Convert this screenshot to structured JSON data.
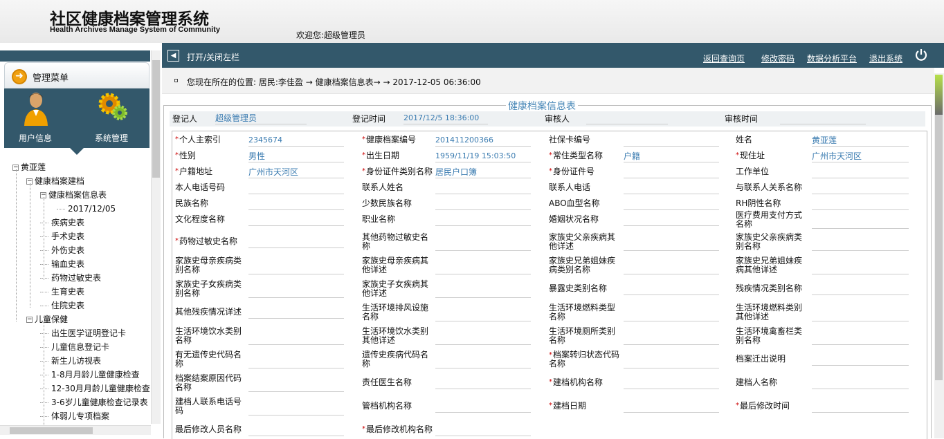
{
  "header": {
    "title": "社区健康档案管理系统",
    "subtitle": "Health Archives Manage System of Community",
    "welcome": "欢迎您:超级管理员"
  },
  "sidebar": {
    "menu_title": "管理菜单",
    "user_label": "用户信息",
    "system_label": "系统管理",
    "tree": [
      {
        "label": "黄亚莲",
        "level": 0,
        "toggle": "-"
      },
      {
        "label": "健康档案建档",
        "level": 1,
        "toggle": "-"
      },
      {
        "label": "健康档案信息表",
        "level": 2,
        "toggle": "-"
      },
      {
        "label": "2017/12/05",
        "level": 3,
        "toggle": ""
      },
      {
        "label": "疾病史表",
        "level": 2,
        "toggle": ""
      },
      {
        "label": "手术史表",
        "level": 2,
        "toggle": ""
      },
      {
        "label": "外伤史表",
        "level": 2,
        "toggle": ""
      },
      {
        "label": "输血史表",
        "level": 2,
        "toggle": ""
      },
      {
        "label": "药物过敏史表",
        "level": 2,
        "toggle": ""
      },
      {
        "label": "生育史表",
        "level": 2,
        "toggle": ""
      },
      {
        "label": "住院史表",
        "level": 2,
        "toggle": ""
      },
      {
        "label": "儿童保健",
        "level": 1,
        "toggle": "-"
      },
      {
        "label": "出生医学证明登记卡",
        "level": 2,
        "toggle": ""
      },
      {
        "label": "儿童信息登记卡",
        "level": 2,
        "toggle": ""
      },
      {
        "label": "新生儿访视表",
        "level": 2,
        "toggle": ""
      },
      {
        "label": "1-8月月龄儿童健康检查",
        "level": 2,
        "toggle": ""
      },
      {
        "label": "12-30月月龄儿童健康检查",
        "level": 2,
        "toggle": ""
      },
      {
        "label": "3-6岁儿童健康检查记录表",
        "level": 2,
        "toggle": ""
      },
      {
        "label": "体弱儿专项档案",
        "level": 2,
        "toggle": ""
      }
    ]
  },
  "topbar": {
    "toggle_label": "打开/关闭左栏",
    "links": [
      "返回查询页",
      "修改密码",
      "数据分析平台",
      "退出系统"
    ]
  },
  "breadcrumb": "您现在所在的位置:  居民:李佳盈 → 健康档案信息表→ → 2017-12-05 06:36:00",
  "form": {
    "legend": "健康档案信息表",
    "registrar_label": "登记人",
    "registrar_value": "超级管理员",
    "reg_time_label": "登记时间",
    "reg_time_value": "2017/12/5 18:36:00",
    "reviewer_label": "审核人",
    "reviewer_value": "",
    "review_time_label": "审核时间",
    "review_time_value": "",
    "rows": [
      [
        [
          "*",
          "个人主索引",
          "2345674"
        ],
        [
          "*",
          "健康档案编号",
          "201411200366"
        ],
        [
          "",
          "社保卡编号",
          ""
        ],
        [
          "",
          "姓名",
          "黄亚莲"
        ]
      ],
      [
        [
          "*",
          "性别",
          "男性"
        ],
        [
          "*",
          "出生日期",
          "1959/11/19 15:03:50"
        ],
        [
          "*",
          "常住类型名称",
          "户籍"
        ],
        [
          "*",
          "现住址",
          "广州市天河区"
        ]
      ],
      [
        [
          "*",
          "户籍地址",
          "广州市天河区"
        ],
        [
          "*",
          "身份证件类别名称",
          "居民户口簿"
        ],
        [
          "*",
          "身份证件号",
          ""
        ],
        [
          "",
          "工作单位",
          ""
        ]
      ],
      [
        [
          "",
          "本人电话号码",
          ""
        ],
        [
          "",
          "联系人姓名",
          ""
        ],
        [
          "",
          "联系人电话",
          ""
        ],
        [
          "",
          "与联系人关系名称",
          ""
        ]
      ],
      [
        [
          "",
          "民族名称",
          ""
        ],
        [
          "",
          "少数民族名称",
          ""
        ],
        [
          "",
          "ABO血型名称",
          ""
        ],
        [
          "",
          "RH阴性名称",
          ""
        ]
      ],
      [
        [
          "",
          "文化程度名称",
          ""
        ],
        [
          "",
          "职业名称",
          ""
        ],
        [
          "",
          "婚姻状况名称",
          ""
        ],
        [
          "",
          "医疗费用支付方式名称",
          ""
        ]
      ],
      [
        [
          "*",
          "药物过敏史名称",
          ""
        ],
        [
          "",
          "其他药物过敏史名称",
          ""
        ],
        [
          "",
          "家族史父亲疾病其他详述",
          ""
        ],
        [
          "",
          "家族史父亲疾病类别名称",
          ""
        ]
      ],
      [
        [
          "",
          "家族史母亲疾病类别名称",
          ""
        ],
        [
          "",
          "家族史母亲疾病其他详述",
          ""
        ],
        [
          "",
          "家族史兄弟姐妹疾病类别名称",
          ""
        ],
        [
          "",
          "家族史兄弟姐妹疾病其他详述",
          ""
        ]
      ],
      [
        [
          "",
          "家族史子女疾病类别名称",
          ""
        ],
        [
          "",
          "家族史子女疾病其他详述",
          ""
        ],
        [
          "",
          "暴露史类别名称",
          ""
        ],
        [
          "",
          "残疾情况类别名称",
          ""
        ]
      ],
      [
        [
          "",
          "其他残疾情况详述",
          ""
        ],
        [
          "",
          "生活环境排风设施名称",
          ""
        ],
        [
          "",
          "生活环境燃料类型名称",
          ""
        ],
        [
          "",
          "生活环境燃料类别其他详述",
          ""
        ]
      ],
      [
        [
          "",
          "生活环境饮水类别名称",
          ""
        ],
        [
          "",
          "生活环境饮水类别其他详述",
          ""
        ],
        [
          "",
          "生活环境厕所类别名称",
          ""
        ],
        [
          "",
          "生活环境禽畜栏类别名称",
          ""
        ]
      ],
      [
        [
          "",
          "有无遗传史代码名称",
          ""
        ],
        [
          "",
          "遗传史疾病代码名称",
          ""
        ],
        [
          "*",
          "档案转归状态代码名称",
          ""
        ],
        [
          "",
          "档案迁出说明",
          ""
        ]
      ],
      [
        [
          "",
          "档案结案原因代码名称",
          ""
        ],
        [
          "",
          "责任医生名称",
          ""
        ],
        [
          "*",
          "建档机构名称",
          ""
        ],
        [
          "",
          "建档人名称",
          ""
        ]
      ],
      [
        [
          "",
          "建档人联系电话号码",
          ""
        ],
        [
          "",
          "管档机构名称",
          ""
        ],
        [
          "*",
          "建档日期",
          ""
        ],
        [
          "*",
          "最后修改时间",
          ""
        ]
      ],
      [
        [
          "",
          "最后修改人员名称",
          ""
        ],
        [
          "*",
          "最后修改机构名称",
          ""
        ],
        [
          "",
          "",
          " "
        ],
        [
          "",
          "",
          " "
        ]
      ]
    ]
  },
  "colors": {
    "header_bar": "#33586b",
    "link_blue": "#3a7bb0",
    "required": "#cc0000"
  }
}
